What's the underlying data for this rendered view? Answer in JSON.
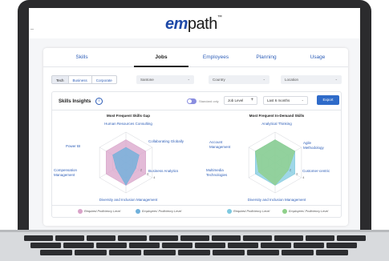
{
  "logo": {
    "part1": "em",
    "part2": "path",
    "tm": "™"
  },
  "tabs": [
    {
      "label": "Skills"
    },
    {
      "label": "Jobs"
    },
    {
      "label": "Employees"
    },
    {
      "label": "Planning"
    },
    {
      "label": "Usage"
    }
  ],
  "active_tab": "Jobs",
  "segments": [
    "Tech",
    "Business",
    "Corporate"
  ],
  "active_segment": "Tech",
  "filters": {
    "company": "Santone",
    "country": "Country",
    "location": "Location"
  },
  "panel": {
    "title": "Skills Insights",
    "toggle_label": "Standard only",
    "job_level": "Job Level",
    "job_level_add": "+",
    "period": "Last 6 months",
    "export": "Export"
  },
  "chart_data": [
    {
      "type": "radar",
      "title": "Most Frequent Skills Gap",
      "axes": [
        "Human Resources Consulting",
        "Collaborating Globally",
        "Business Analytics",
        "Diversity and Inclusion Management",
        "Compensation Management",
        "Power BI"
      ],
      "tick_labels": [
        "2",
        "3",
        "4"
      ],
      "series": [
        {
          "name": "Required Proficiency Level",
          "color": "#d9a3c9",
          "values": [
            3,
            3,
            3,
            3,
            3,
            3
          ]
        },
        {
          "name": "Employees' Proficiency Level",
          "color": "#6fb0db",
          "values": [
            2,
            2,
            1.5,
            3,
            1.5,
            2
          ]
        }
      ],
      "rmax": 4
    },
    {
      "type": "radar",
      "title": "Most Frequent In-Demand Skills",
      "axes": [
        "Analytical Thinking",
        "Agile Methodology",
        "Customer-centric",
        "Diversity and Inclusion Management",
        "Multimedia Technologies",
        "Account Management"
      ],
      "tick_labels": [
        "2",
        "3",
        "4"
      ],
      "series": [
        {
          "name": "Required Proficiency Level",
          "color": "#7ec9e0",
          "values": [
            3,
            3,
            3,
            3,
            3,
            3
          ]
        },
        {
          "name": "Employees' Proficiency Level",
          "color": "#8fd08a",
          "values": [
            3,
            3,
            2,
            3,
            2.5,
            3
          ]
        }
      ],
      "rmax": 4
    }
  ],
  "colors": {
    "brand_blue": "#1f4aa8",
    "link_blue": "#2f5fb8",
    "export_blue": "#2f6bc9"
  }
}
